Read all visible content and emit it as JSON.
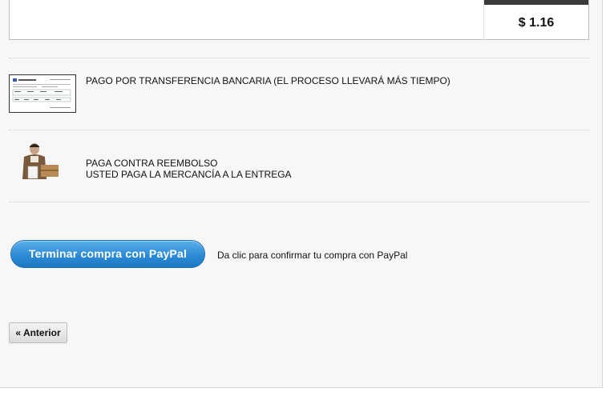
{
  "order": {
    "total": "$ 1.16"
  },
  "payment_options": [
    {
      "id": "bank-transfer",
      "lines": [
        "PAGO POR TRANSFERENCIA BANCARIA (EL PROCESO LLEVARÁ MÁS TIEMPO)"
      ],
      "image": "bank-transfer-form-thumbnail"
    },
    {
      "id": "cash-on-delivery",
      "lines": [
        "PAGA CONTRA REEMBOLSO",
        "USTED PAGA LA MERCANCÍA A LA ENTREGA"
      ],
      "image": "delivery-person-holding-package"
    }
  ],
  "paypal": {
    "button_label": "Terminar compra con PayPal",
    "hint": "Da clic para confirmar tu compra con PayPal"
  },
  "navigation": {
    "previous_label": "« Anterior"
  },
  "colors": {
    "paypal_button": "#2d8bd6",
    "panel_background": "#f7f7f7",
    "total_header_bar": "#3a3a3a"
  }
}
